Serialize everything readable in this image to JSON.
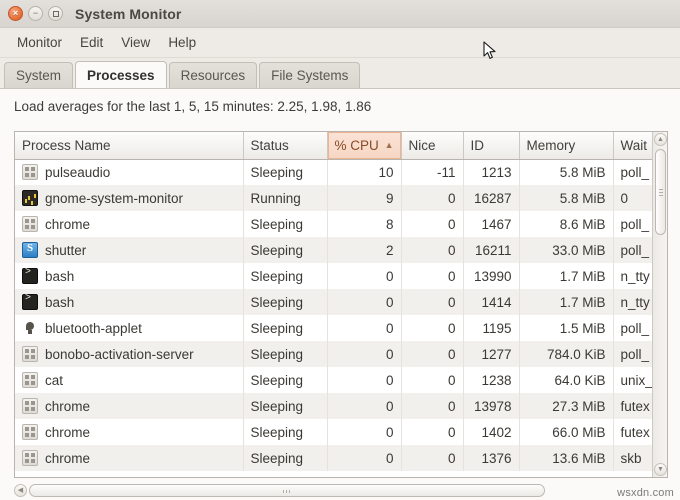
{
  "window": {
    "title": "System Monitor",
    "buttons": {
      "close": "×",
      "minimize": "−",
      "maximize": ""
    }
  },
  "menubar": {
    "items": [
      {
        "label": "Monitor"
      },
      {
        "label": "Edit"
      },
      {
        "label": "View"
      },
      {
        "label": "Help"
      }
    ]
  },
  "tabs": [
    {
      "label": "System",
      "active": false
    },
    {
      "label": "Processes",
      "active": true
    },
    {
      "label": "Resources",
      "active": false
    },
    {
      "label": "File Systems",
      "active": false
    }
  ],
  "main": {
    "load_averages": "Load averages for the last 1, 5, 15 minutes: 2.25, 1.98, 1.86",
    "columns": [
      {
        "key": "name",
        "label": "Process Name",
        "sorted": false
      },
      {
        "key": "status",
        "label": "Status",
        "sorted": false
      },
      {
        "key": "cpu",
        "label": "% CPU",
        "sorted": true,
        "sort_arrow": "▲"
      },
      {
        "key": "nice",
        "label": "Nice",
        "sorted": false
      },
      {
        "key": "id",
        "label": "ID",
        "sorted": false
      },
      {
        "key": "memory",
        "label": "Memory",
        "sorted": false
      },
      {
        "key": "wait",
        "label": "Wait",
        "sorted": false
      }
    ],
    "rows": [
      {
        "icon": "generic",
        "name": "pulseaudio",
        "status": "Sleeping",
        "cpu": "10",
        "nice": "-11",
        "id": "1213",
        "memory": "5.8 MiB",
        "wait": "poll_"
      },
      {
        "icon": "monitor",
        "name": "gnome-system-monitor",
        "status": "Running",
        "cpu": "9",
        "nice": "0",
        "id": "16287",
        "memory": "5.8 MiB",
        "wait": "0"
      },
      {
        "icon": "generic",
        "name": "chrome",
        "status": "Sleeping",
        "cpu": "8",
        "nice": "0",
        "id": "1467",
        "memory": "8.6 MiB",
        "wait": "poll_"
      },
      {
        "icon": "shutter",
        "name": "shutter",
        "status": "Sleeping",
        "cpu": "2",
        "nice": "0",
        "id": "16211",
        "memory": "33.0 MiB",
        "wait": "poll_"
      },
      {
        "icon": "terminal",
        "name": "bash",
        "status": "Sleeping",
        "cpu": "0",
        "nice": "0",
        "id": "13990",
        "memory": "1.7 MiB",
        "wait": "n_tty"
      },
      {
        "icon": "terminal",
        "name": "bash",
        "status": "Sleeping",
        "cpu": "0",
        "nice": "0",
        "id": "1414",
        "memory": "1.7 MiB",
        "wait": "n_tty"
      },
      {
        "icon": "bluetooth",
        "name": "bluetooth-applet",
        "status": "Sleeping",
        "cpu": "0",
        "nice": "0",
        "id": "1195",
        "memory": "1.5 MiB",
        "wait": "poll_"
      },
      {
        "icon": "generic",
        "name": "bonobo-activation-server",
        "status": "Sleeping",
        "cpu": "0",
        "nice": "0",
        "id": "1277",
        "memory": "784.0 KiB",
        "wait": "poll_"
      },
      {
        "icon": "generic",
        "name": "cat",
        "status": "Sleeping",
        "cpu": "0",
        "nice": "0",
        "id": "1238",
        "memory": "64.0 KiB",
        "wait": "unix_"
      },
      {
        "icon": "generic",
        "name": "chrome",
        "status": "Sleeping",
        "cpu": "0",
        "nice": "0",
        "id": "13978",
        "memory": "27.3 MiB",
        "wait": "futex"
      },
      {
        "icon": "generic",
        "name": "chrome",
        "status": "Sleeping",
        "cpu": "0",
        "nice": "0",
        "id": "1402",
        "memory": "66.0 MiB",
        "wait": "futex"
      },
      {
        "icon": "generic",
        "name": "chrome",
        "status": "Sleeping",
        "cpu": "0",
        "nice": "0",
        "id": "1376",
        "memory": "13.6 MiB",
        "wait": "skb"
      }
    ]
  },
  "scrollbars": {
    "vertical_up": "▲",
    "vertical_down": "▼",
    "horizontal_left": "◀"
  },
  "watermark": "wsxdn.com",
  "colors": {
    "sort_highlight": "#f6d6c3",
    "close_button": "#e8743c",
    "window_chrome": "#e8e5e0",
    "row_stripe": "#f1f0ed"
  }
}
